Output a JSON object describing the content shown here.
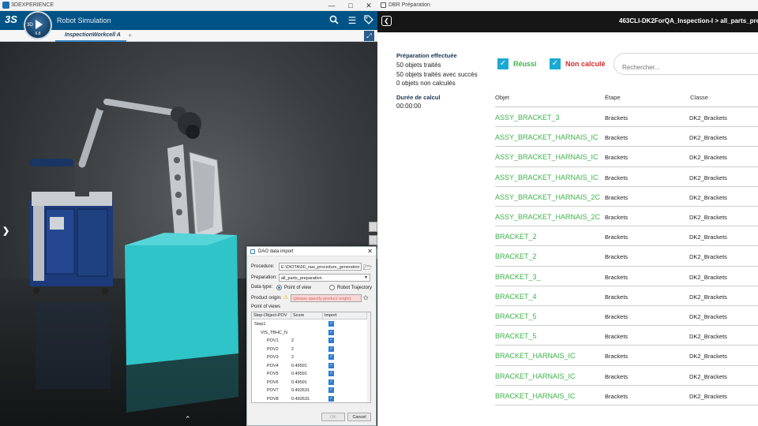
{
  "left_window": {
    "titlebar": "3DEXPERIENCE",
    "app_title": "Robot Simulation",
    "compass": {
      "label_3d": "3D",
      "version": "6.8"
    },
    "tab": "InspectionWorkcell A",
    "tab_add": "+",
    "icons": [
      "search-icon",
      "menu-icon",
      "tag-icon",
      "fit-icon"
    ]
  },
  "dao_dialog": {
    "title": "DAO data import",
    "procedure_label": "Procedure:",
    "procedure_value": "E:\\DIOTA\\00_raw_procedure_generation",
    "preparation_label": "Preparation:",
    "preparation_value": "all_parts_preparation",
    "data_type_label": "Data type:",
    "option_pov": "Point of view",
    "option_traj": "Robot Trajectory",
    "product_origin_label": "Product origin:",
    "product_origin_placeholder": "(please specify product origin)",
    "point_of_views_label": "Point of views",
    "columns": [
      "Step-Object-POV",
      "Score",
      "Import"
    ],
    "rows": [
      {
        "name": "Step1",
        "score": "",
        "indent": 0
      },
      {
        "name": "VIS_TBHC_N",
        "score": "",
        "indent": 1
      },
      {
        "name": "POV1",
        "score": "2",
        "indent": 2
      },
      {
        "name": "POV2",
        "score": "2",
        "indent": 2
      },
      {
        "name": "POV3",
        "score": "2",
        "indent": 2
      },
      {
        "name": "POV4",
        "score": "0.49591",
        "indent": 2
      },
      {
        "name": "POV5",
        "score": "0.49591",
        "indent": 2
      },
      {
        "name": "POV6",
        "score": "0.49591",
        "indent": 2
      },
      {
        "name": "POV7",
        "score": "0.492631",
        "indent": 2
      },
      {
        "name": "POV8",
        "score": "0.492631",
        "indent": 2
      }
    ],
    "ok_label": "OK",
    "cancel_label": "Cancel"
  },
  "right_window": {
    "titlebar": "DBR Préparation",
    "breadcrumb": "463CLI-DK2ForQA_Inspection-I > all_parts_prepara",
    "summary": {
      "heading": "Préparation effectuée",
      "processed": "50 objets traités",
      "success": "50 objets traités avec succès",
      "not_calc": "0 objets non calculés",
      "duration_label": "Durée de calcul",
      "duration_value": "00:00:00"
    },
    "filters": {
      "reussi": "Réussi",
      "non_calcule": "Non calculé"
    },
    "search_placeholder": "Rechercher...",
    "columns": {
      "objet": "Objet",
      "etape": "Étape",
      "classe": "Classe"
    },
    "rows": [
      {
        "objet": "ASSY_BRACKET_3",
        "etape": "Brackets",
        "classe": "DK2_Brackets"
      },
      {
        "objet": "ASSY_BRACKET_HARNAIS_IC",
        "etape": "Brackets",
        "classe": "DK2_Brackets"
      },
      {
        "objet": "ASSY_BRACKET_HARNAIS_IC",
        "etape": "Brackets",
        "classe": "DK2_Brackets"
      },
      {
        "objet": "ASSY_BRACKET_HARNAIS_IC",
        "etape": "Brackets",
        "classe": "DK2_Brackets"
      },
      {
        "objet": "ASSY_BRACKET_HARNAIS_2C",
        "etape": "Brackets",
        "classe": "DK2_Brackets"
      },
      {
        "objet": "ASSY_BRACKET_HARNAIS_2C",
        "etape": "Brackets",
        "classe": "DK2_Brackets"
      },
      {
        "objet": "BRACKET_2",
        "etape": "Brackets",
        "classe": "DK2_Brackets"
      },
      {
        "objet": "BRACKET_2",
        "etape": "Brackets",
        "classe": "DK2_Brackets"
      },
      {
        "objet": "BRACKET_3_",
        "etape": "Brackets",
        "classe": "DK2_Brackets"
      },
      {
        "objet": "BRACKET_4",
        "etape": "Brackets",
        "classe": "DK2_Brackets"
      },
      {
        "objet": "BRACKET_5",
        "etape": "Brackets",
        "classe": "DK2_Brackets"
      },
      {
        "objet": "BRACKET_5",
        "etape": "Brackets",
        "classe": "DK2_Brackets"
      },
      {
        "objet": "BRACKET_HARNAIS_IC",
        "etape": "Brackets",
        "classe": "DK2_Brackets"
      },
      {
        "objet": "BRACKET_HARNAIS_IC",
        "etape": "Brackets",
        "classe": "DK2_Brackets"
      },
      {
        "objet": "BRACKET_HARNAIS_IC",
        "etape": "Brackets",
        "classe": "DK2_Brackets"
      }
    ]
  },
  "colors": {
    "success_green": "#3db34a",
    "error_red": "#d12c2c",
    "checkbox_blue": "#19a9d3",
    "header_blue": "#005386"
  }
}
